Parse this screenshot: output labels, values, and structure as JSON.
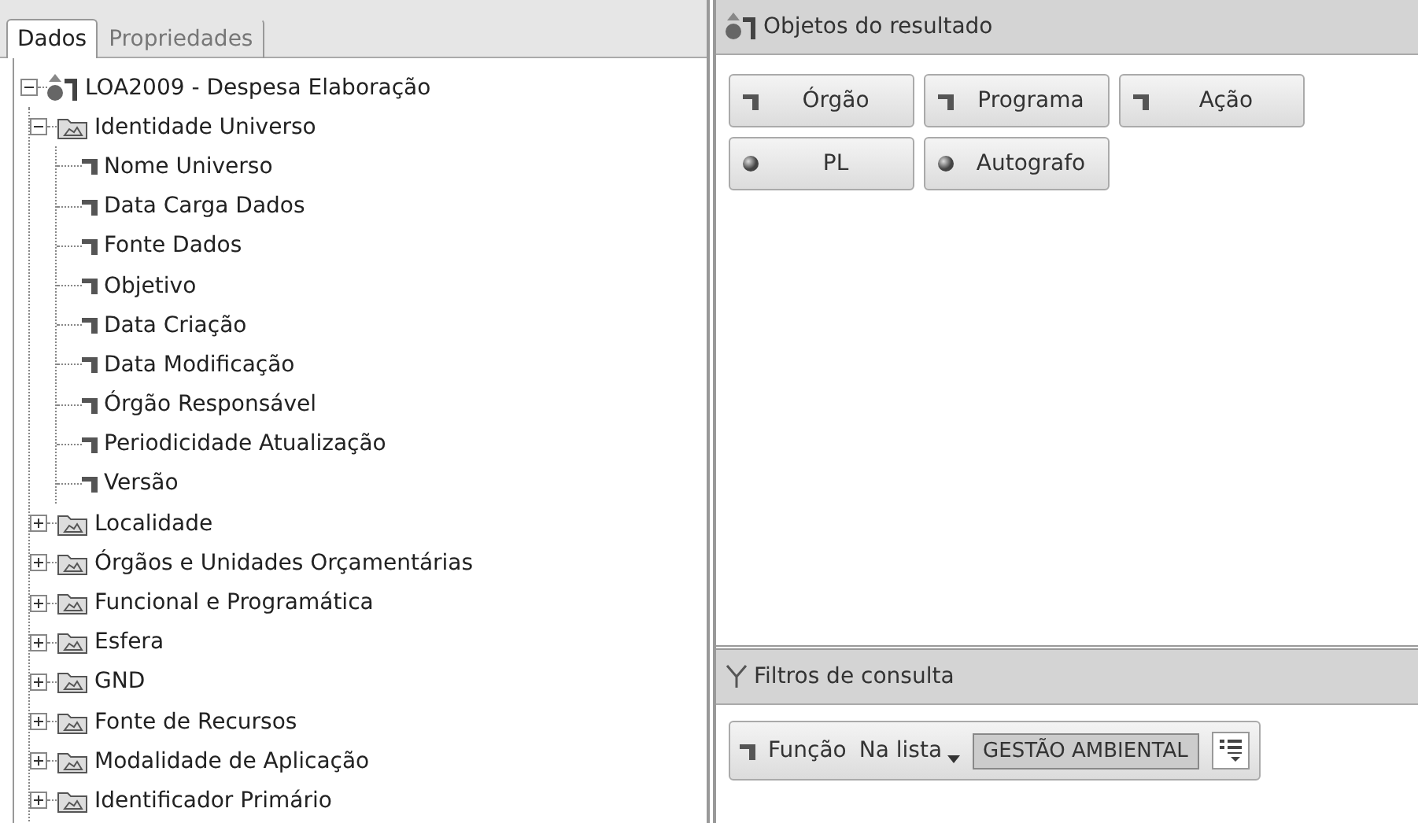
{
  "tabs": [
    {
      "label": "Dados",
      "selected": true
    },
    {
      "label": "Propriedades",
      "selected": false
    }
  ],
  "tree": {
    "label": "LOA2009 - Despesa Elaboração",
    "kind": "universe",
    "expanded": true,
    "children": [
      {
        "label": "Identidade Universo",
        "kind": "folder",
        "expanded": true,
        "children": [
          {
            "label": "Nome Universo",
            "kind": "item"
          },
          {
            "label": "Data Carga Dados",
            "kind": "item"
          },
          {
            "label": "Fonte Dados",
            "kind": "item"
          },
          {
            "label": "Objetivo",
            "kind": "item"
          },
          {
            "label": "Data Criação",
            "kind": "item"
          },
          {
            "label": "Data Modificação",
            "kind": "item"
          },
          {
            "label": "Órgão Responsável",
            "kind": "item"
          },
          {
            "label": "Periodicidade Atualização",
            "kind": "item"
          },
          {
            "label": "Versão",
            "kind": "item"
          }
        ]
      },
      {
        "label": "Localidade",
        "kind": "folder",
        "expanded": false
      },
      {
        "label": "Órgãos e Unidades Orçamentárias",
        "kind": "folder",
        "expanded": false
      },
      {
        "label": "Funcional e Programática",
        "kind": "folder",
        "expanded": false
      },
      {
        "label": "Esfera",
        "kind": "folder",
        "expanded": false
      },
      {
        "label": "GND",
        "kind": "folder",
        "expanded": false
      },
      {
        "label": "Fonte de Recursos",
        "kind": "folder",
        "expanded": false
      },
      {
        "label": "Modalidade de Aplicação",
        "kind": "folder",
        "expanded": false
      },
      {
        "label": "Identificador Primário",
        "kind": "folder",
        "expanded": false
      }
    ]
  },
  "result_objects": {
    "title": "Objetos do resultado",
    "items": [
      {
        "label": "Órgão",
        "kind": "dimension"
      },
      {
        "label": "Programa",
        "kind": "dimension"
      },
      {
        "label": "Ação",
        "kind": "dimension"
      },
      {
        "label": "PL",
        "kind": "measure"
      },
      {
        "label": "Autografo",
        "kind": "measure"
      }
    ]
  },
  "query_filters": {
    "title": "Filtros de consulta",
    "filters": [
      {
        "field": "Função",
        "operator": "Na lista",
        "value": "GESTÃO AMBIENTAL"
      }
    ]
  }
}
